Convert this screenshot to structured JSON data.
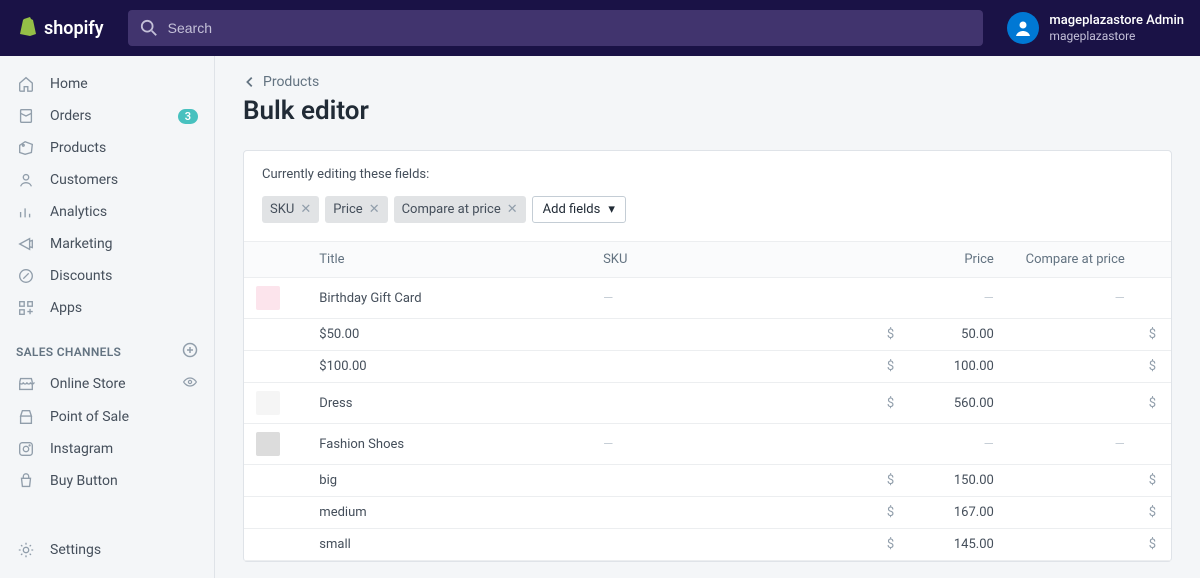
{
  "header": {
    "brand": "shopify",
    "search_placeholder": "Search",
    "user_name": "mageplazastore Admin",
    "store_name": "mageplazastore"
  },
  "sidebar": {
    "nav": [
      {
        "label": "Home",
        "icon": "home"
      },
      {
        "label": "Orders",
        "icon": "orders",
        "badge": "3"
      },
      {
        "label": "Products",
        "icon": "products"
      },
      {
        "label": "Customers",
        "icon": "customers"
      },
      {
        "label": "Analytics",
        "icon": "analytics"
      },
      {
        "label": "Marketing",
        "icon": "marketing"
      },
      {
        "label": "Discounts",
        "icon": "discounts"
      },
      {
        "label": "Apps",
        "icon": "apps"
      }
    ],
    "channels_header": "SALES CHANNELS",
    "channels": [
      {
        "label": "Online Store",
        "icon": "store",
        "eye": true
      },
      {
        "label": "Point of Sale",
        "icon": "pos"
      },
      {
        "label": "Instagram",
        "icon": "instagram"
      },
      {
        "label": "Buy Button",
        "icon": "buy"
      }
    ],
    "settings": "Settings"
  },
  "page": {
    "back": "Products",
    "title": "Bulk editor",
    "editing_label": "Currently editing these fields:",
    "chips": [
      "SKU",
      "Price",
      "Compare at price"
    ],
    "add_fields": "Add fields",
    "columns": {
      "title": "Title",
      "sku": "SKU",
      "price": "Price",
      "compare": "Compare at price"
    },
    "rows": [
      {
        "type": "product",
        "title": "Birthday Gift Card",
        "thumb": "#fce4ec",
        "sku": "—",
        "price": "—",
        "compare": "—"
      },
      {
        "type": "variant",
        "title": "$50.00",
        "curr": "$",
        "price": "50.00",
        "cmpcurr": "$"
      },
      {
        "type": "variant",
        "title": "$100.00",
        "curr": "$",
        "price": "100.00",
        "cmpcurr": "$"
      },
      {
        "type": "product",
        "title": "Dress",
        "thumb": "#f5f5f5",
        "curr": "$",
        "price": "560.00",
        "cmpcurr": "$"
      },
      {
        "type": "product",
        "title": "Fashion Shoes",
        "thumb": "#dcdcdc",
        "sku": "—",
        "price": "—",
        "compare": "—"
      },
      {
        "type": "variant",
        "title": "big",
        "curr": "$",
        "price": "150.00",
        "cmpcurr": "$"
      },
      {
        "type": "variant",
        "title": "medium",
        "curr": "$",
        "price": "167.00",
        "cmpcurr": "$"
      },
      {
        "type": "variant",
        "title": "small",
        "curr": "$",
        "price": "145.00",
        "cmpcurr": "$"
      }
    ]
  }
}
